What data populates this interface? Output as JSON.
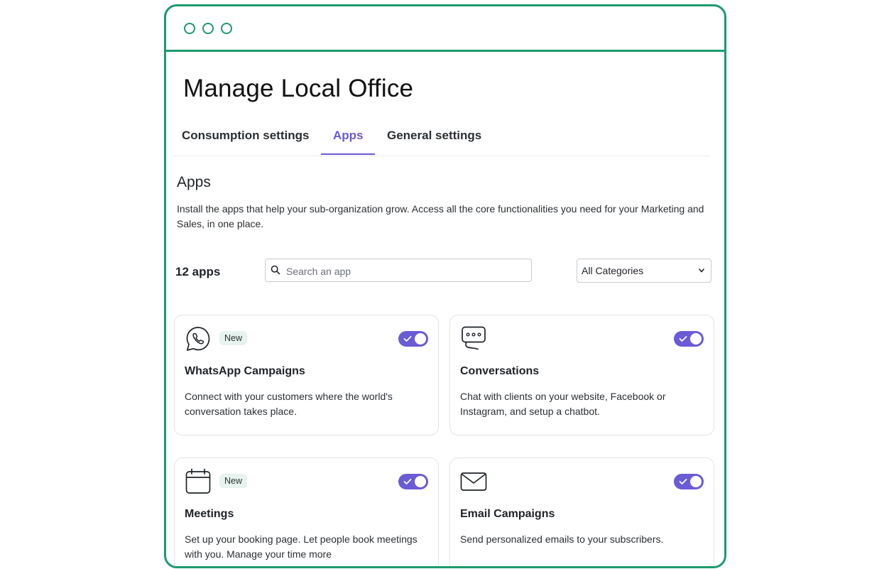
{
  "page": {
    "title": "Manage Local Office"
  },
  "tabs": [
    {
      "label": "Consumption settings",
      "active": false
    },
    {
      "label": "Apps",
      "active": true
    },
    {
      "label": "General settings",
      "active": false
    }
  ],
  "section": {
    "title": "Apps",
    "description": "Install the apps that help your sub-organization grow. Access all the core functionalities you need for your Marketing and Sales, in one place."
  },
  "toolbar": {
    "count_label": "12 apps",
    "search_placeholder": "Search an app",
    "search_value": "",
    "category_selected": "All Categories"
  },
  "apps": [
    {
      "name": "WhatsApp Campaigns",
      "icon": "whatsapp-icon",
      "badge": "New",
      "enabled": true,
      "description": "Connect with your customers where the world's conversation takes place."
    },
    {
      "name": "Conversations",
      "icon": "chat-bubble-icon",
      "badge": "",
      "enabled": true,
      "description": "Chat with clients on your website, Facebook or Instagram, and setup a chatbot."
    },
    {
      "name": "Meetings",
      "icon": "calendar-icon",
      "badge": "New",
      "enabled": true,
      "description": "Set up your booking page. Let people book meetings with you. Manage your time more"
    },
    {
      "name": "Email Campaigns",
      "icon": "envelope-icon",
      "badge": "",
      "enabled": true,
      "description": "Send personalized emails to your subscribers."
    }
  ],
  "colors": {
    "frame_border": "#1d9a6c",
    "accent": "#6a5bd6",
    "badge_bg": "#e6f3ee",
    "card_border": "#e3e4e7"
  }
}
